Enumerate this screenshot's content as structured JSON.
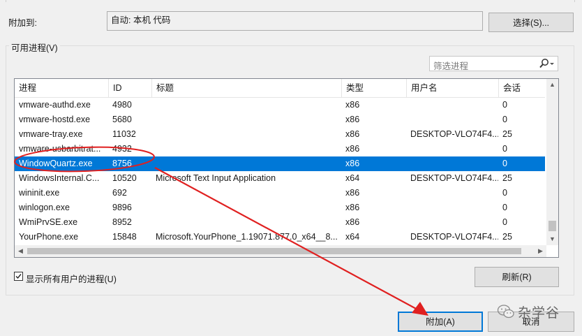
{
  "attach_to": {
    "label": "附加到:",
    "value": "自动: 本机 代码",
    "select_button": "选择(S)..."
  },
  "available_processes": {
    "title": "可用进程(V)",
    "filter_placeholder": "筛选进程",
    "columns": [
      "进程",
      "ID",
      "标题",
      "类型",
      "用户名",
      "会话"
    ],
    "rows": [
      {
        "process": "vmware-authd.exe",
        "id": "4980",
        "title": "",
        "type": "x86",
        "user": "",
        "session": "0"
      },
      {
        "process": "vmware-hostd.exe",
        "id": "5680",
        "title": "",
        "type": "x86",
        "user": "",
        "session": "0"
      },
      {
        "process": "vmware-tray.exe",
        "id": "11032",
        "title": "",
        "type": "x86",
        "user": "DESKTOP-VLO74F4...",
        "session": "25"
      },
      {
        "process": "vmware-usbarbitrat...",
        "id": "4932",
        "title": "",
        "type": "x86",
        "user": "",
        "session": "0"
      },
      {
        "process": "WindowQuartz.exe",
        "id": "8756",
        "title": "",
        "type": "x86",
        "user": "",
        "session": "0",
        "selected": true
      },
      {
        "process": "WindowsInternal.C...",
        "id": "10520",
        "title": "Microsoft Text Input Application",
        "type": "x64",
        "user": "DESKTOP-VLO74F4...",
        "session": "25"
      },
      {
        "process": "wininit.exe",
        "id": "692",
        "title": "",
        "type": "x86",
        "user": "",
        "session": "0"
      },
      {
        "process": "winlogon.exe",
        "id": "9896",
        "title": "",
        "type": "x86",
        "user": "",
        "session": "0"
      },
      {
        "process": "WmiPrvSE.exe",
        "id": "8952",
        "title": "",
        "type": "x86",
        "user": "",
        "session": "0"
      },
      {
        "process": "YourPhone.exe",
        "id": "15848",
        "title": "Microsoft.YourPhone_1.19071.877.0_x64__8...",
        "type": "x64",
        "user": "DESKTOP-VLO74F4...",
        "session": "25"
      }
    ],
    "show_all_users": {
      "label": "显示所有用户的进程(U)",
      "checked": true
    },
    "refresh_button": "刷新(R)"
  },
  "footer": {
    "attach_button": "附加(A)",
    "cancel_button": "取消"
  },
  "watermark": "杂学谷",
  "colors": {
    "selection": "#0078d7",
    "annotation": "#e02020"
  }
}
